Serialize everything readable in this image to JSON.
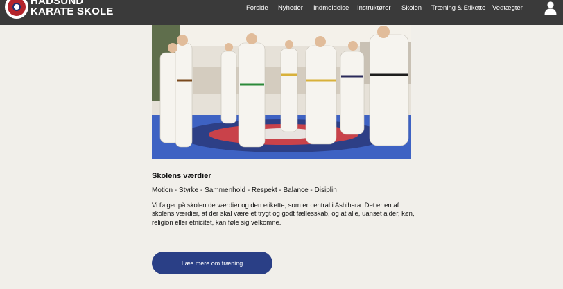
{
  "header": {
    "brand_line1": "HADSUND",
    "brand_line2": "KARATE SKOLE",
    "nav": [
      "Forside",
      "Nyheder",
      "Indmeldelse",
      "Instruktører",
      "Skolen",
      "Træning & Etikette",
      "Vedtægter"
    ],
    "user_icon": "user-icon",
    "bar_color": "#3a3a3a"
  },
  "main": {
    "photo_alt": "karate-class-photo",
    "values_heading": "Skolens værdier",
    "values_list": "Motion - Styrke - Sammenhold - Respekt - Balance - Disiplin",
    "values_text": "Vi følger på skolen de værdier og den etikette, som er central i Ashihara. Det er en af skolens værdier, at der skal være et trygt og godt fællesskab, og at alle, uanset alder, køn, religion eller etnicitet, kan føle sig velkomne.",
    "cta_label": "Læs mere om træning",
    "cta_color": "#2a3f86"
  }
}
